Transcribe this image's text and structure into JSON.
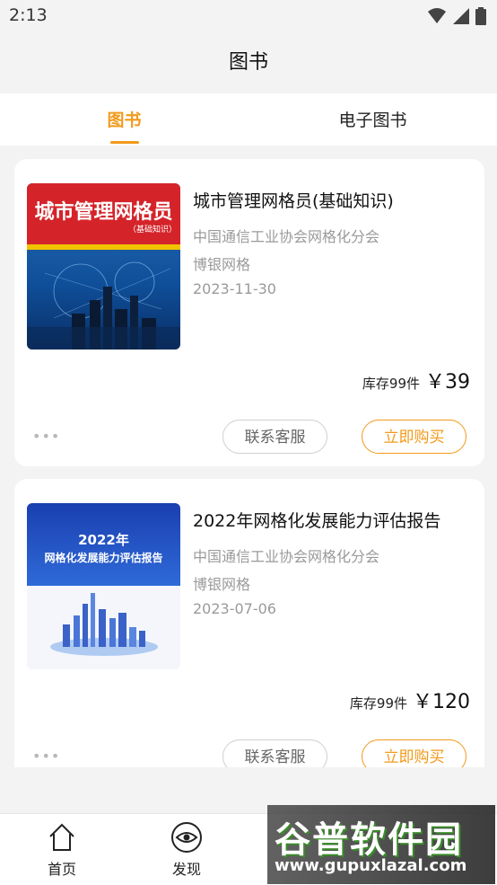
{
  "status_bar": {
    "time": "2:13"
  },
  "header": {
    "title": "图书"
  },
  "tabs": [
    {
      "label": "图书",
      "active": true
    },
    {
      "label": "电子图书",
      "active": false
    }
  ],
  "books": [
    {
      "title": "城市管理网格员(基础知识)",
      "publisher": "中国通信工业协会网格化分会",
      "author": "博银网格",
      "date": "2023-11-30",
      "stock": "库存99件",
      "price": "￥39",
      "cover_title": "城市管理网格员",
      "cover_subtitle": "（基础知识）",
      "contact_label": "联系客服",
      "buy_label": "立即购买",
      "more_label": "•••"
    },
    {
      "title": "2022年网格化发展能力评估报告",
      "publisher": "中国通信工业协会网格化分会",
      "author": "博银网格",
      "date": "2023-07-06",
      "stock": "库存99件",
      "price": "￥120",
      "cover_title": "2022年",
      "cover_subtitle": "网格化发展能力评估报告",
      "contact_label": "联系客服",
      "buy_label": "立即购买",
      "more_label": "•••"
    }
  ],
  "bottom_nav": [
    {
      "label": "首页",
      "icon": "home-icon"
    },
    {
      "label": "发现",
      "icon": "eye-icon"
    }
  ],
  "watermark": {
    "line1": "谷普软件园",
    "line2": "www.gupuxlazal.com"
  },
  "colors": {
    "accent": "#f29a1b",
    "background": "#f3f3f3"
  }
}
